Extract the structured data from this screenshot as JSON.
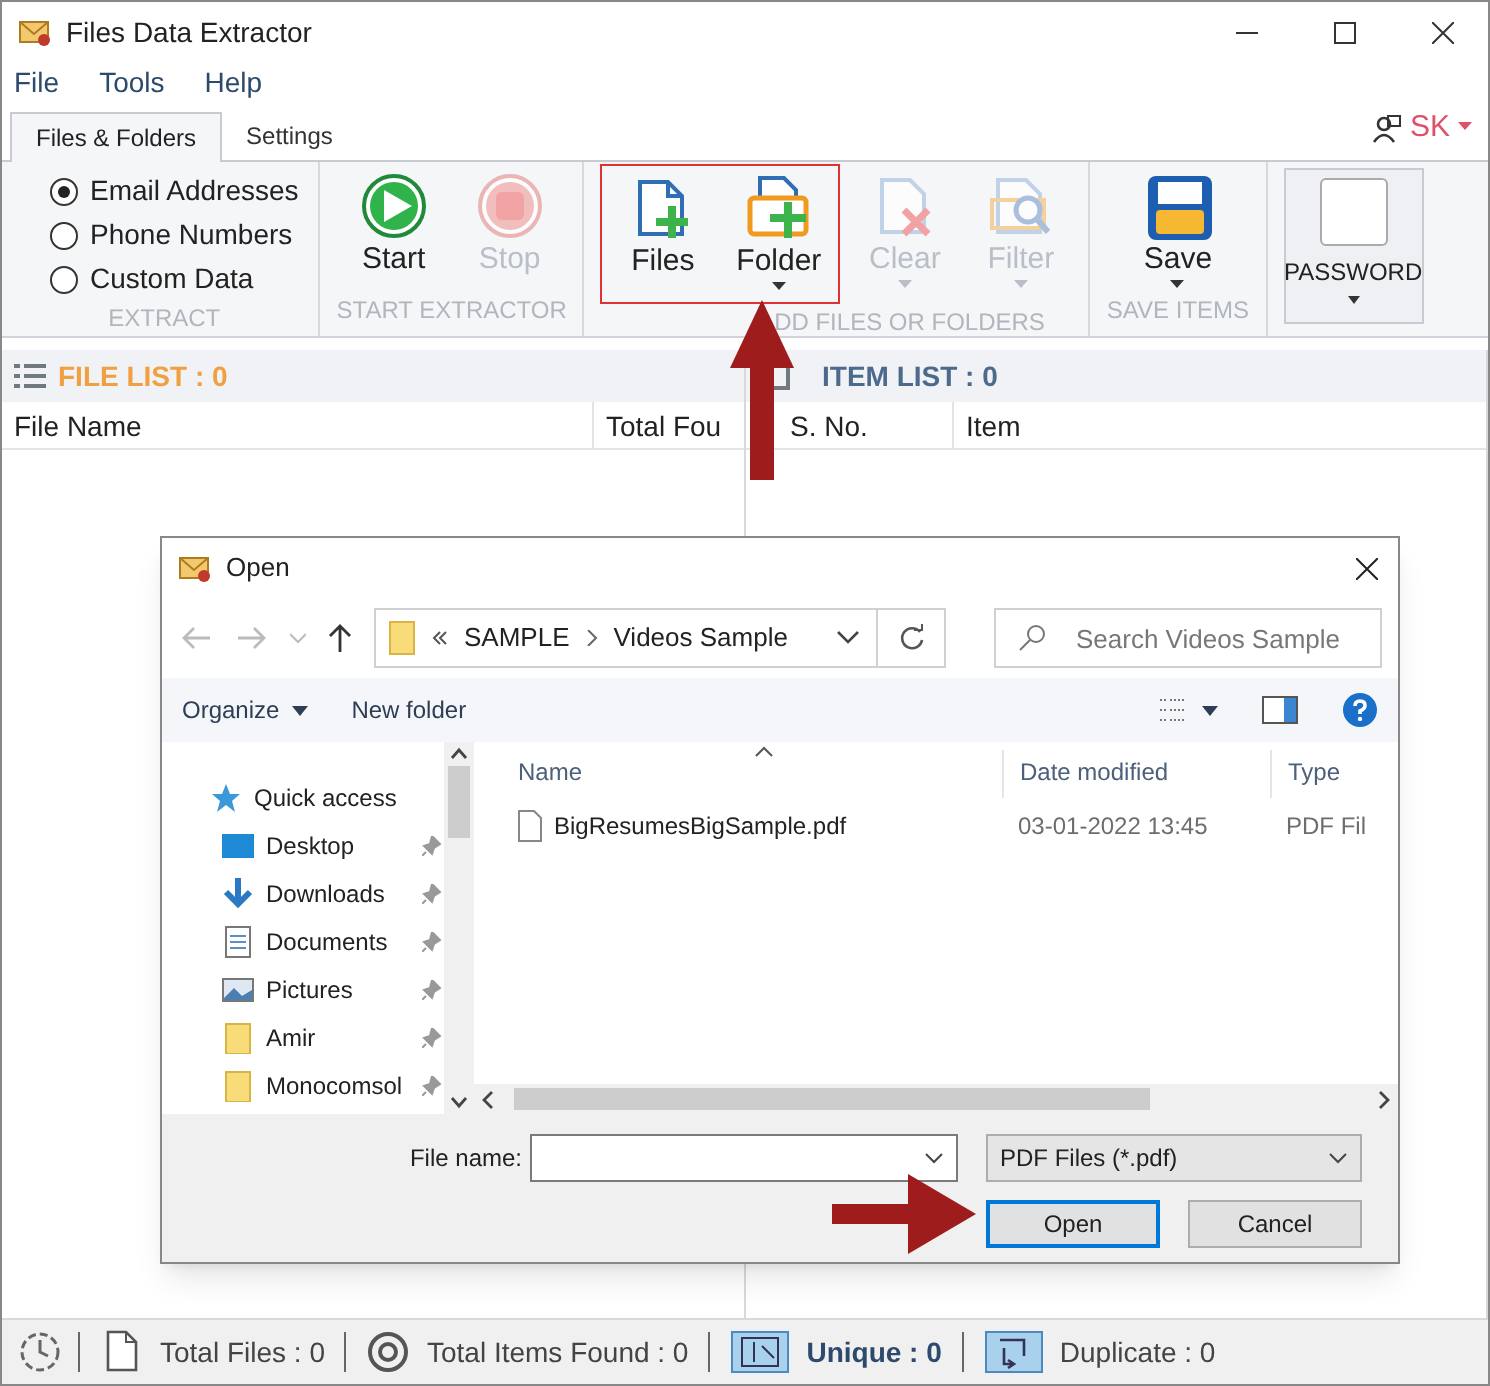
{
  "window": {
    "title": "Files Data Extractor"
  },
  "menu": [
    "File",
    "Tools",
    "Help"
  ],
  "tabs": [
    {
      "label": "Files & Folders",
      "selected": true
    },
    {
      "label": "Settings",
      "selected": false
    }
  ],
  "user": {
    "initials": "SK"
  },
  "ribbon": {
    "groups": [
      {
        "kind": "radios",
        "label": "EXTRACT",
        "options": [
          {
            "label": "Email Addresses",
            "selected": true
          },
          {
            "label": "Phone Numbers",
            "selected": false
          },
          {
            "label": "Custom Data",
            "selected": false
          }
        ]
      },
      {
        "kind": "buttons",
        "label": "START EXTRACTOR",
        "buttons": [
          {
            "label": "Start",
            "kind": "play",
            "disabled": false,
            "dropdown": false,
            "highlighted": false
          },
          {
            "label": "Stop",
            "kind": "stop",
            "disabled": true,
            "dropdown": false,
            "highlighted": false
          }
        ]
      },
      {
        "kind": "buttons",
        "label": "DD FILES OR FOLDERS",
        "buttons": [
          {
            "label": "Files",
            "kind": "file-add",
            "disabled": false,
            "dropdown": false,
            "highlighted": true
          },
          {
            "label": "Folder",
            "kind": "folder-add",
            "disabled": false,
            "dropdown": true,
            "highlighted": true
          },
          {
            "label": "Clear",
            "kind": "clear",
            "disabled": true,
            "dropdown": true,
            "highlighted": false
          },
          {
            "label": "Filter",
            "kind": "filter",
            "disabled": true,
            "dropdown": true,
            "highlighted": false
          }
        ]
      },
      {
        "kind": "buttons",
        "label": "SAVE ITEMS",
        "buttons": [
          {
            "label": "Save",
            "kind": "save",
            "disabled": false,
            "dropdown": true,
            "highlighted": false
          }
        ]
      },
      {
        "kind": "password",
        "label": "PASSWORD"
      }
    ]
  },
  "file_list": {
    "title": "FILE LIST : 0",
    "columns": [
      "File Name",
      "Total Fou"
    ]
  },
  "item_list": {
    "title": "ITEM LIST : 0",
    "columns": [
      "S. No.",
      "Item"
    ]
  },
  "dialog": {
    "title": "Open",
    "path": [
      "SAMPLE",
      "Videos Sample"
    ],
    "search_placeholder": "Search Videos Sample",
    "toolbar": [
      "Organize",
      "New folder"
    ],
    "nav": [
      {
        "label": "Quick access",
        "kind": "star",
        "pinned": false
      },
      {
        "label": "Desktop",
        "kind": "desktop",
        "pinned": true
      },
      {
        "label": "Downloads",
        "kind": "download",
        "pinned": true
      },
      {
        "label": "Documents",
        "kind": "document",
        "pinned": true
      },
      {
        "label": "Pictures",
        "kind": "pictures",
        "pinned": true
      },
      {
        "label": "Amir",
        "kind": "folder",
        "pinned": true
      },
      {
        "label": "Monocomsol",
        "kind": "folder",
        "pinned": true
      }
    ],
    "columns": [
      "Name",
      "Date modified",
      "Type"
    ],
    "files": [
      {
        "name": "BigResumesBigSample.pdf",
        "date": "03-01-2022 13:45",
        "type": "PDF Fil"
      }
    ],
    "file_name_label": "File name:",
    "filter": "PDF Files (*.pdf)",
    "buttons": [
      {
        "label": "Open",
        "default": true
      },
      {
        "label": "Cancel",
        "default": false
      }
    ]
  },
  "status_bar": [
    {
      "label": "Total Files : 0",
      "kind": "file",
      "emphasized": false
    },
    {
      "label": "Total Items Found : 0",
      "kind": "at",
      "emphasized": false
    },
    {
      "label": "Unique : 0",
      "kind": "unique",
      "emphasized": true
    },
    {
      "label": "Duplicate : 0",
      "kind": "duplicate",
      "emphasized": false
    }
  ]
}
